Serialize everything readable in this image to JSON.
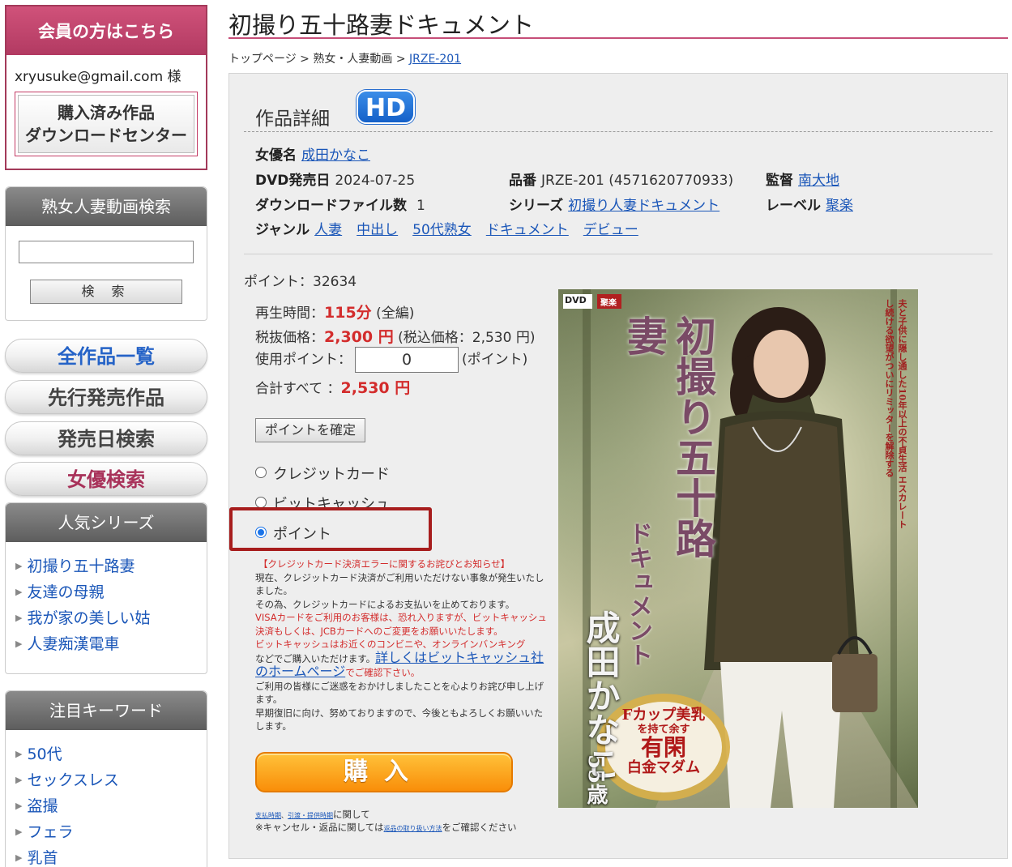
{
  "sidebar": {
    "member_header": "会員の方はこちら",
    "member_email": "xryusuke@gmail.com 様",
    "download_center": [
      "購入済み作品",
      "ダウンロードセンター"
    ],
    "search_header": "熟女人妻動画検索",
    "search_value": "",
    "search_button": "検 索",
    "nav": [
      "全作品一覧",
      "先行発売作品",
      "発売日検索",
      "女優検索"
    ],
    "popular_header": "人気シリーズ",
    "popular_series": [
      "初撮り五十路妻",
      "友達の母親",
      "我が家の美しい姑",
      "人妻痴漢電車"
    ],
    "keyword_header": "注目キーワード",
    "keywords": [
      "50代",
      "セックスレス",
      "盗撮",
      "フェラ",
      "乳首"
    ]
  },
  "main": {
    "title": "初撮り五十路妻ドキュメント",
    "breadcrumb": {
      "top": "トップページ",
      "sep1": " > ",
      "category": "熟女・人妻動画",
      "sep2": " > ",
      "current": "JRZE-201"
    },
    "detail": {
      "heading": "作品詳細",
      "hd_badge": "HD",
      "actress_label": "女優名",
      "actress": "成田かなこ",
      "release_label": "DVD発売日",
      "release": "2024-07-25",
      "product_label": "品番",
      "product": "JRZE-201 (4571620770933)",
      "director_label": "監督",
      "director": "南大地",
      "files_label": "ダウンロードファイル数",
      "files": "1",
      "series_label": "シリーズ",
      "series": "初撮り人妻ドキュメント",
      "label_label": "レーベル",
      "label": "聚楽",
      "genre_label": "ジャンル",
      "genres": [
        "人妻",
        "中出し",
        "50代熟女",
        "ドキュメント",
        "デビュー"
      ]
    },
    "purchase": {
      "points_line": "ポイント：32634",
      "duration_label": "再生時間：",
      "duration": "115分",
      "duration_note": "(全編)",
      "price_label": "税抜価格：",
      "price": "2,300 円",
      "price_tax": "(税込価格：2,530 円)",
      "use_points_label": "使用ポイント：",
      "use_points": "0",
      "use_points_unit": "(ポイント)",
      "total_label": "合計すべて ：",
      "total": "2,530 円",
      "confirm_button": "ポイントを確定",
      "payment_methods": [
        {
          "label": "クレジットカード",
          "checked": false
        },
        {
          "label": "ビットキャッシュ",
          "checked": false
        },
        {
          "label": "ポイント",
          "checked": true
        }
      ],
      "notice": {
        "title": "【クレジットカード決済エラーに関するお詫びとお知らせ】",
        "p1": "現在、クレジットカード決済がご利用いただけない事象が発生いたしました。",
        "p2": "その為、クレジットカードによるお支払いを止めております。",
        "p3": "VISAカードをご利用のお客様は、恐れ入りますが、ビットキャッシュ決済もしくは、JCBカードへのご変更をお願いいたします。",
        "p4": "ビットキャッシュはお近くのコンビニや、オンラインバンキング",
        "p5a": "などでご購入いただけます。",
        "p5_link": "詳しくはビットキャッシュ社のホームページ",
        "p5b": "でご確認下さい。",
        "p6": "ご利用の皆様にご迷惑をおかけしましたことを心よりお詫び申し上げます。",
        "p7": "早期復旧に向け、努めておりますので、今後ともよろしくお願いいたします。"
      },
      "buy_button": "購入",
      "footer1_link1": "支払時期",
      "footer1_sep": "、",
      "footer1_link2": "引渡・提供時期",
      "footer1_tail": "に関して",
      "footer2_head": "※キャンセル・返品に関しては",
      "footer2_link": "返品の取り扱い方法",
      "footer2_tail": "をご確認ください"
    },
    "cover": {
      "title_main": "初撮り五十路妻",
      "title_sub": "ドキュメント",
      "tagline": "夫と子供に隠し通した10年以上の不貞生活 エスカレートし続ける欲望がついにリミッターを解除する",
      "actress": "成田かなこ",
      "age": "55歳",
      "catch": [
        "Fカップ美乳",
        "を持て余す",
        "有閑",
        "白金マダム"
      ],
      "dvd_logo": "DVD",
      "studio_logo": "聚楽"
    }
  }
}
